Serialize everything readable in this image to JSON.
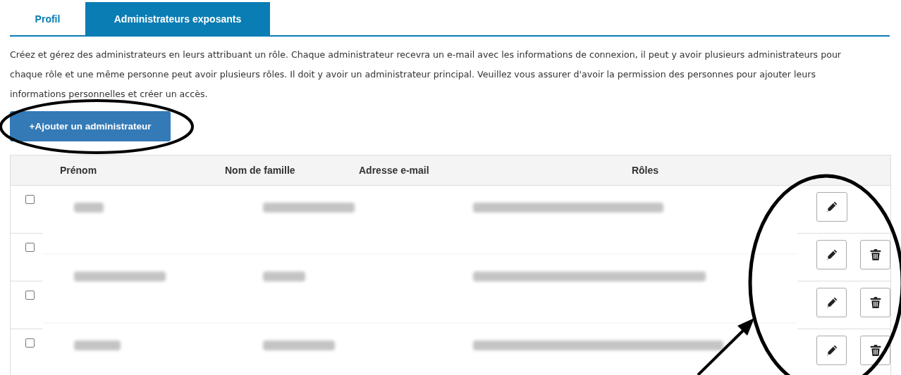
{
  "tabs": [
    {
      "label": "Profil",
      "selected": false
    },
    {
      "label": "Administrateurs exposants",
      "selected": true
    }
  ],
  "description": "Créez et gérez des administrateurs en leurs attribuant un rôle. Chaque administrateur recevra un e-mail avec les informations de connexion, il peut y avoir plusieurs administrateurs pour chaque rôle et une même personne peut avoir plusieurs rôles. Il doit y avoir un administrateur principal. Veuillez vous assurer d'avoir la permission des personnes pour ajouter leurs informations personnelles et créer un accès.",
  "add_button": "+Ajouter un administrateur",
  "table": {
    "columns": [
      "Prénom",
      "Nom de famille",
      "Adresse e-mail",
      "Rôles"
    ],
    "rows": [
      {
        "checked": false,
        "delete_button": false
      },
      {
        "checked": false,
        "delete_button": true
      },
      {
        "checked": false,
        "delete_button": true
      },
      {
        "checked": false,
        "delete_button": true
      }
    ]
  }
}
